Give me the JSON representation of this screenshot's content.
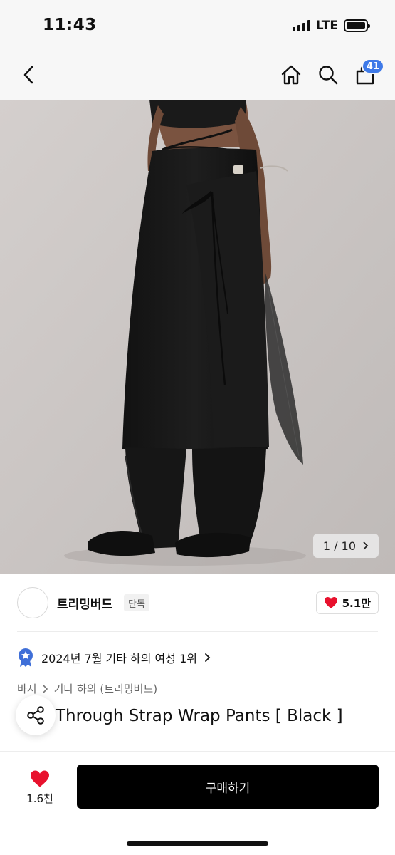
{
  "status": {
    "time": "11:43",
    "network": "LTE"
  },
  "nav": {
    "cart_count": "41"
  },
  "image": {
    "counter": "1 / 10"
  },
  "brand": {
    "name": "트리밍버드",
    "tag": "단독",
    "likes": "5.1만"
  },
  "ranking": {
    "text": "2024년 7월 기타 하의 여성 1위"
  },
  "category": {
    "items": [
      "바지",
      "기타 하의 (트리밍버드)"
    ]
  },
  "product": {
    "title_visible": "Through Strap Wrap Pants [ Black ]"
  },
  "bottom": {
    "wish_count": "1.6천",
    "buy_label": "구매하기"
  },
  "colors": {
    "accent": "#3f7ae8",
    "heart": "#e8112d",
    "buy_button": "#000000"
  }
}
